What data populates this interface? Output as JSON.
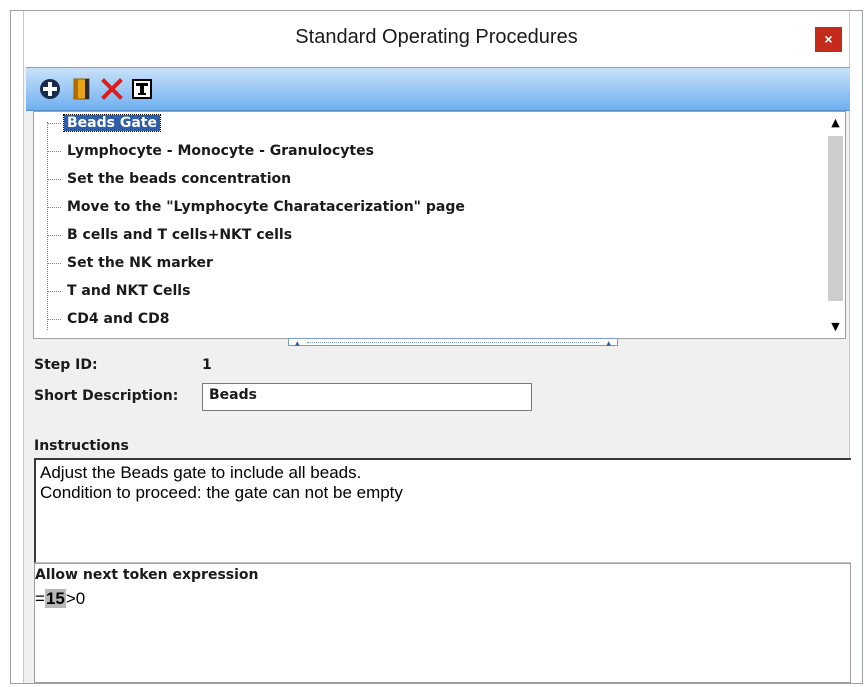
{
  "window": {
    "title": "Standard Operating Procedures",
    "close_label": "×"
  },
  "toolbar": {
    "icons": [
      "add-icon",
      "bookmark-icon",
      "delete-icon",
      "text-icon"
    ]
  },
  "tree": {
    "items": [
      {
        "label": "Beads Gate",
        "selected": true
      },
      {
        "label": "Lymphocyte - Monocyte - Granulocytes",
        "selected": false
      },
      {
        "label": "Set the beads concentration",
        "selected": false
      },
      {
        "label": "Move to the \"Lymphocyte Charatacerization\" page",
        "selected": false
      },
      {
        "label": "B cells and T cells+NKT cells",
        "selected": false
      },
      {
        "label": "Set the NK marker",
        "selected": false
      },
      {
        "label": "T and NKT Cells",
        "selected": false
      },
      {
        "label": "CD4 and CD8",
        "selected": false
      }
    ]
  },
  "step": {
    "id_label": "Step ID:",
    "id_value": "1"
  },
  "short_description": {
    "label": "Short Description:",
    "value": "Beads"
  },
  "instructions": {
    "label": "Instructions",
    "text": "Adjust the Beads gate to include all beads.\nCondition to proceed: the gate can not be empty"
  },
  "token": {
    "label": "Allow next token expression",
    "prefix": "=",
    "highlight": "15",
    "suffix": ">0"
  },
  "colors": {
    "selection": "#2f5ea8",
    "close": "#c42b1c",
    "toolbar_top": "#c9e1f9",
    "toolbar_bottom": "#6fb0f0"
  }
}
